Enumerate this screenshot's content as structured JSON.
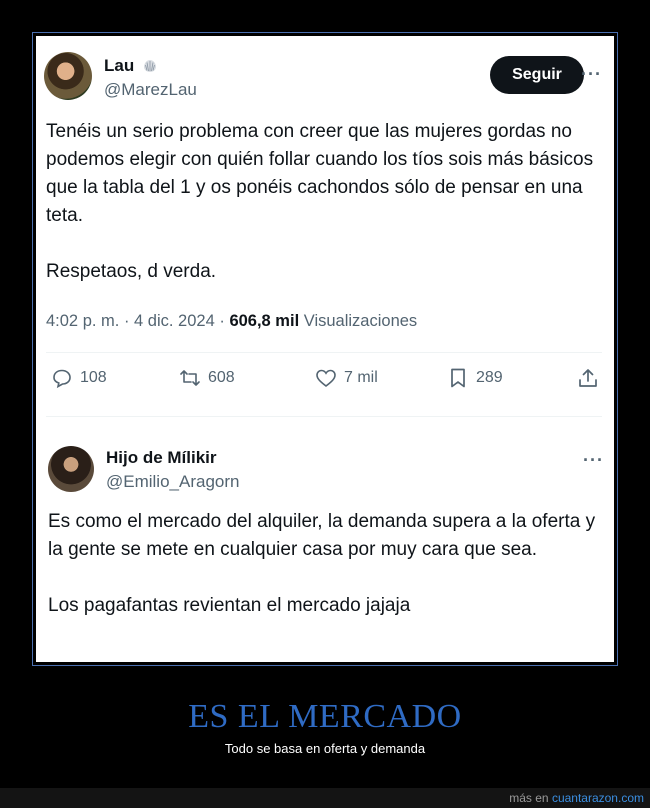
{
  "tweet": {
    "display_name": "Lau",
    "handle": "@MarezLau",
    "follow_label": "Seguir",
    "more_label": "···",
    "paragraphs": [
      "Tenéis un serio problema con creer que las mujeres gordas no podemos elegir con quién follar cuando los tíos sois más básicos que la tabla del 1 y os ponéis cachondos sólo de pensar en una teta.",
      "Respetaos, d verda."
    ],
    "timestamp": "4:02 p. m. · 4 dic. 2024 · ",
    "views_count": "606,8 mil",
    "views_label": "Visualizaciones",
    "actions": {
      "replies": "108",
      "retweets": "608",
      "likes": "7 mil",
      "bookmarks": "289"
    },
    "icons": [
      "shell-badge-icon",
      "reply-icon",
      "retweet-icon",
      "like-icon",
      "bookmark-icon",
      "share-icon"
    ]
  },
  "reply": {
    "display_name": "Hijo de Mílikir",
    "handle": "@Emilio_Aragorn",
    "more_label": "···",
    "paragraphs": [
      "Es como el mercado del alquiler, la demanda supera a la oferta y la gente se mete en cualquier casa por muy cara que sea.",
      "Los pagafantas revientan el mercado jajaja"
    ]
  },
  "caption": {
    "title": "ES EL MERCADO",
    "subtitle": "Todo se basa en oferta y demanda"
  },
  "footer": {
    "prefix": "más en ",
    "site": "cuantarazon.com"
  },
  "colors": {
    "accent_blue": "#2f6bc4",
    "link_blue": "#3b8ee0",
    "text_primary": "#0f1419",
    "text_secondary": "#536471"
  }
}
